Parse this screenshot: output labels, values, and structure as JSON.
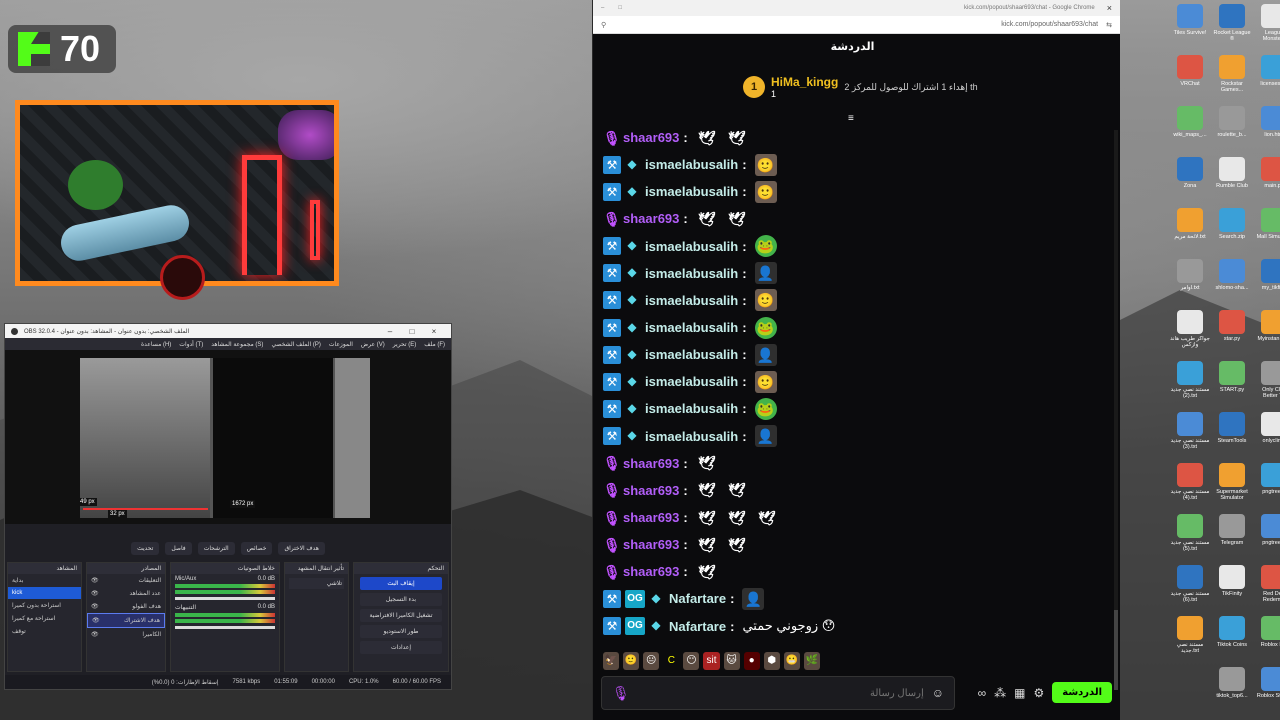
{
  "kick_overlay": {
    "count": "70"
  },
  "obs": {
    "title": "OBS 32.0.4 - الملف الشخصي: بدون عنوان - المشاهد: بدون عنوان",
    "menu": [
      "ملف (F)",
      "تحرير (E)",
      "عرض (V)",
      "الموزعات",
      "الملف الشخصي (P)",
      "مجموعة المشاهد (S)",
      "أدوات (T)",
      "مساعدة (H)"
    ],
    "preview_labels": {
      "left": "49 px",
      "bottom": "32 px",
      "right": "1672 px"
    },
    "controls": [
      "تحديث",
      "فاصل",
      "الترشحات",
      "خصائص",
      "هدف الاختراق"
    ],
    "scenes_title": "المشاهد",
    "scenes": [
      "بداية",
      "kick",
      "استراحة بدون كميرا",
      "استراحة مع كميرا",
      "توقف"
    ],
    "sources_title": "المصادر",
    "sources": [
      "التعليقات",
      "عدد المشاهد",
      "هدف الفولو",
      "هدف الاشتراك",
      "الكاميرا"
    ],
    "mixer_title": "خلاط الصوتيات",
    "mixer": [
      {
        "name": "Mic/Aux",
        "db": "0.0 dB"
      },
      {
        "name": "التنبيهات",
        "db": "0.0 dB"
      }
    ],
    "transitions_title": "تأثير انتقال المشهد",
    "transition_value": "تلاشي",
    "controls_title": "التحكم",
    "control_buttons": [
      "إيقاف البث",
      "بدء التسجيل",
      "تشغيل الكاميرا الافتراضية",
      "طور الاستوديو",
      "إعدادات"
    ],
    "status": {
      "frames": "إسقاط الإطارات: 0 (0.0%)",
      "kbps": "7581 kbps",
      "time": "01:55:09",
      "rec": "00:00:00",
      "cpu": "CPU: 1.0%",
      "fps": "60.00 / 60.00 FPS"
    }
  },
  "chrome": {
    "tab_title": "kick.com/popout/shaar693/chat - Google Chrome",
    "url": "kick.com/popout/shaar693/chat"
  },
  "chat": {
    "header": "الدردشة",
    "pinned": {
      "rank": "1",
      "name": "HiMa_kingg",
      "subs": "1",
      "text": "إهداء 1 اشتراك للوصول للمركز 2 th"
    },
    "messages": [
      {
        "user": "shaar693",
        "badges": "mic",
        "color": "#b25ef8",
        "emotes": [
          "duck",
          "duck"
        ],
        "text": ""
      },
      {
        "user": "ismaelabusalih",
        "badges": "mod",
        "color": "#c4ece8",
        "emotes": [
          "face"
        ],
        "text": ""
      },
      {
        "user": "ismaelabusalih",
        "badges": "mod",
        "color": "#c4ece8",
        "emotes": [
          "face"
        ],
        "text": ""
      },
      {
        "user": "shaar693",
        "badges": "mic",
        "color": "#b25ef8",
        "emotes": [
          "duck",
          "duck"
        ],
        "text": ""
      },
      {
        "user": "ismaelabusalih",
        "badges": "mod",
        "color": "#c4ece8",
        "emotes": [
          "frog"
        ],
        "text": ""
      },
      {
        "user": "ismaelabusalih",
        "badges": "mod",
        "color": "#c4ece8",
        "emotes": [
          "dark"
        ],
        "text": ""
      },
      {
        "user": "ismaelabusalih",
        "badges": "mod",
        "color": "#c4ece8",
        "emotes": [
          "face"
        ],
        "text": ""
      },
      {
        "user": "ismaelabusalih",
        "badges": "mod",
        "color": "#c4ece8",
        "emotes": [
          "frog"
        ],
        "text": ""
      },
      {
        "user": "ismaelabusalih",
        "badges": "mod",
        "color": "#c4ece8",
        "emotes": [
          "dark"
        ],
        "text": ""
      },
      {
        "user": "ismaelabusalih",
        "badges": "mod",
        "color": "#c4ece8",
        "emotes": [
          "face"
        ],
        "text": ""
      },
      {
        "user": "ismaelabusalih",
        "badges": "mod",
        "color": "#c4ece8",
        "emotes": [
          "frog"
        ],
        "text": ""
      },
      {
        "user": "ismaelabusalih",
        "badges": "mod",
        "color": "#c4ece8",
        "emotes": [
          "dark"
        ],
        "text": ""
      },
      {
        "user": "shaar693",
        "badges": "mic",
        "color": "#b25ef8",
        "emotes": [
          "duck"
        ],
        "text": ""
      },
      {
        "user": "shaar693",
        "badges": "mic",
        "color": "#b25ef8",
        "emotes": [
          "duck",
          "duck"
        ],
        "text": ""
      },
      {
        "user": "shaar693",
        "badges": "mic",
        "color": "#b25ef8",
        "emotes": [
          "duck",
          "duck",
          "duck"
        ],
        "text": ""
      },
      {
        "user": "shaar693",
        "badges": "mic",
        "color": "#b25ef8",
        "emotes": [
          "duck",
          "duck"
        ],
        "text": ""
      },
      {
        "user": "shaar693",
        "badges": "mic",
        "color": "#b25ef8",
        "emotes": [
          "duck"
        ],
        "text": ""
      },
      {
        "user": "Nafartare",
        "badges": "og",
        "color": "#c4ece8",
        "emotes": [
          "dark"
        ],
        "text": ""
      },
      {
        "user": "Nafartare",
        "badges": "og",
        "color": "#c4ece8",
        "emotes": [],
        "text": "زوجوني حمتي 😯"
      }
    ],
    "placeholder": "إرسال رسالة",
    "send_label": "الدردشة"
  },
  "desktop_icons": [
    {
      "label": "Tiles Survive!",
      "col": 0,
      "row": 0
    },
    {
      "label": "Rocket League ®",
      "col": 1,
      "row": 0
    },
    {
      "label": "League Monsters",
      "col": 2,
      "row": 0
    },
    {
      "label": "VRChat",
      "col": 0,
      "row": 1
    },
    {
      "label": "Rockstar Games...",
      "col": 1,
      "row": 1
    },
    {
      "label": "licenses.py",
      "col": 2,
      "row": 1
    },
    {
      "label": "wiki_maps_...",
      "col": 0,
      "row": 2
    },
    {
      "label": "roulette_b...",
      "col": 1,
      "row": 2
    },
    {
      "label": "lion.htm",
      "col": 2,
      "row": 2
    },
    {
      "label": "Zona",
      "col": 0,
      "row": 3
    },
    {
      "label": "Rumble Club",
      "col": 1,
      "row": 3
    },
    {
      "label": "main.py",
      "col": 2,
      "row": 3
    },
    {
      "label": "لائحة مريم.txt",
      "col": 0,
      "row": 4
    },
    {
      "label": "Search.zip",
      "col": 1,
      "row": 4
    },
    {
      "label": "Mall Simulator",
      "col": 2,
      "row": 4
    },
    {
      "label": "اوامر.txt",
      "col": 0,
      "row": 5
    },
    {
      "label": "shlomo-sha...",
      "col": 1,
      "row": 5
    },
    {
      "label": "my_tikfinit",
      "col": 2,
      "row": 5
    },
    {
      "label": "جواكر طريب هاند وازكس",
      "col": 0,
      "row": 6
    },
    {
      "label": "star.py",
      "col": 1,
      "row": 6
    },
    {
      "label": "Myinstan App",
      "col": 2,
      "row": 6
    },
    {
      "label": "مستند نصي جديد (2).txt",
      "col": 0,
      "row": 7
    },
    {
      "label": "START.py",
      "col": 1,
      "row": 7
    },
    {
      "label": "Only Clim Better To",
      "col": 2,
      "row": 7
    },
    {
      "label": "مستند نصي جديد (3).txt",
      "col": 0,
      "row": 8
    },
    {
      "label": "SteamTools",
      "col": 1,
      "row": 8
    },
    {
      "label": "onlyclimb",
      "col": 2,
      "row": 8
    },
    {
      "label": "مستند نصي جديد (4).txt",
      "col": 0,
      "row": 9
    },
    {
      "label": "Supermarket Simulator",
      "col": 1,
      "row": 9
    },
    {
      "label": "pngtree-d",
      "col": 2,
      "row": 9
    },
    {
      "label": "مستند نصي جديد (5).txt",
      "col": 0,
      "row": 10
    },
    {
      "label": "Telegram",
      "col": 1,
      "row": 10
    },
    {
      "label": "pngtree-n",
      "col": 2,
      "row": 10
    },
    {
      "label": "مستند نصي جديد (6).txt",
      "col": 0,
      "row": 11
    },
    {
      "label": "TikFinity",
      "col": 1,
      "row": 11
    },
    {
      "label": "Red Dea Redempt",
      "col": 2,
      "row": 11
    },
    {
      "label": "مستند نصي جديد.txt",
      "col": 0,
      "row": 12
    },
    {
      "label": "Tiktok Coins",
      "col": 1,
      "row": 12
    },
    {
      "label": "Roblox Pla",
      "col": 2,
      "row": 12
    },
    {
      "label": "tiktok_top6...",
      "col": 1,
      "row": 13
    },
    {
      "label": "Roblox Studio",
      "col": 2,
      "row": 13
    }
  ]
}
